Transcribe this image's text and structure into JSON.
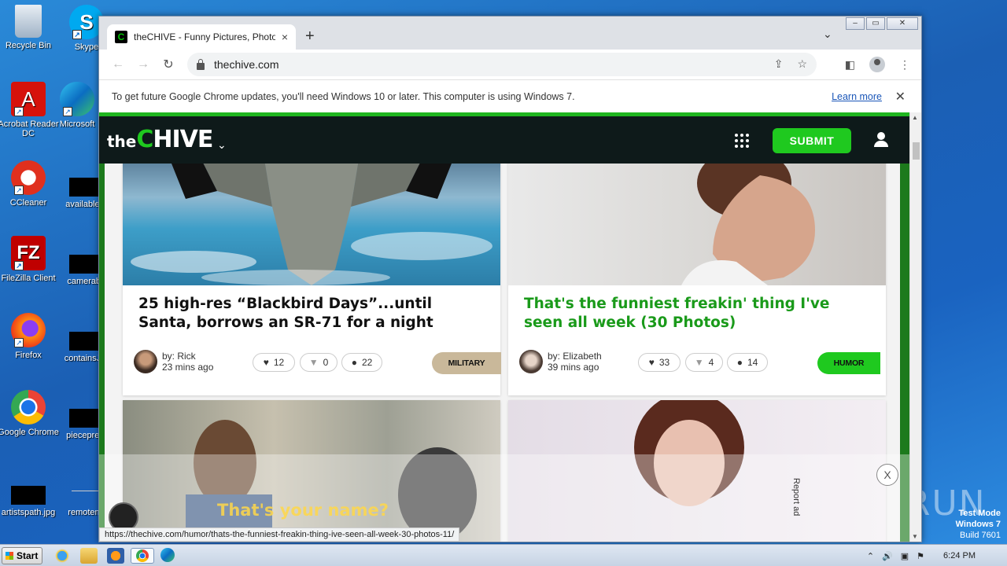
{
  "desktop": {
    "icons": [
      {
        "label": "Recycle Bin"
      },
      {
        "label": "Skype"
      },
      {
        "label": "Acrobat Reader DC"
      },
      {
        "label": "Microsoft"
      },
      {
        "label": "CCleaner"
      },
      {
        "label": "availablea"
      },
      {
        "label": "FileZilla Client"
      },
      {
        "label": "camerabi"
      },
      {
        "label": "Firefox"
      },
      {
        "label": "containsJa"
      },
      {
        "label": "Google Chrome"
      },
      {
        "label": "piecepres"
      },
      {
        "label": "artistspath.jpg"
      },
      {
        "label": "remotem"
      }
    ],
    "watermark": {
      "line1": "Test Mode",
      "line2": "Windows 7",
      "line3": "Build 7601"
    },
    "anyrun": "ANY RUN"
  },
  "browser": {
    "tab_title": "theCHIVE - Funny Pictures, Photos,",
    "tab_close": "×",
    "new_tab": "+",
    "url": "thechive.com",
    "infobar": {
      "message": "To get future Google Chrome updates, you'll need Windows 10 or later. This computer is using Windows 7.",
      "link": "Learn more"
    },
    "status_url": "https://thechive.com/humor/thats-the-funniest-freakin-thing-ive-seen-all-week-30-photos-11/"
  },
  "site": {
    "logo_the": "the",
    "logo_c": "C",
    "logo_hive": "HIVE",
    "submit": "SUBMIT",
    "report_ad": "Report ad",
    "ad_close": "X",
    "video_caption": "That's your name?",
    "cards": [
      {
        "title": "25 high-res “Blackbird Days”...until Santa, borrows an SR-71 for a night",
        "author": "by: Rick",
        "time": "23 mins ago",
        "likes": "12",
        "dislikes": "0",
        "comments": "22",
        "tag": "MILITARY",
        "tag_color": "#c9b89a"
      },
      {
        "title": "That's the funniest freakin' thing I've seen all week (30 Photos)",
        "author": "by: Elizabeth",
        "time": "39 mins ago",
        "likes": "33",
        "dislikes": "4",
        "comments": "14",
        "tag": "HUMOR",
        "tag_color": "#1fc91f"
      }
    ]
  },
  "taskbar": {
    "start": "Start",
    "clock": "6:24 PM"
  }
}
